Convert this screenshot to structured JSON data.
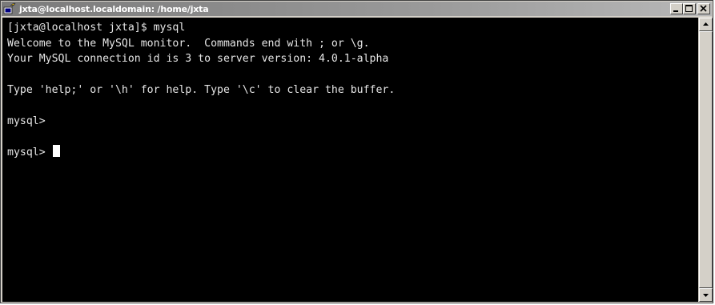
{
  "window": {
    "title": "jxta@localhost.localdomain: /home/jxta",
    "controls": {
      "minimize": "minimize-icon",
      "maximize": "maximize-icon",
      "close": "close-icon"
    }
  },
  "terminal": {
    "background": "#000000",
    "foreground": "#e6e6e6",
    "lines": [
      "[jxta@localhost jxta]$ mysql",
      "Welcome to the MySQL monitor.  Commands end with ; or \\g.",
      "Your MySQL connection id is 3 to server version: 4.0.1-alpha",
      "",
      "Type 'help;' or '\\h' for help. Type '\\c' to clear the buffer.",
      "",
      "mysql>",
      "",
      "mysql> "
    ]
  },
  "scrollbar": {
    "up_icon": "up-arrow-icon",
    "down_icon": "down-arrow-icon"
  }
}
